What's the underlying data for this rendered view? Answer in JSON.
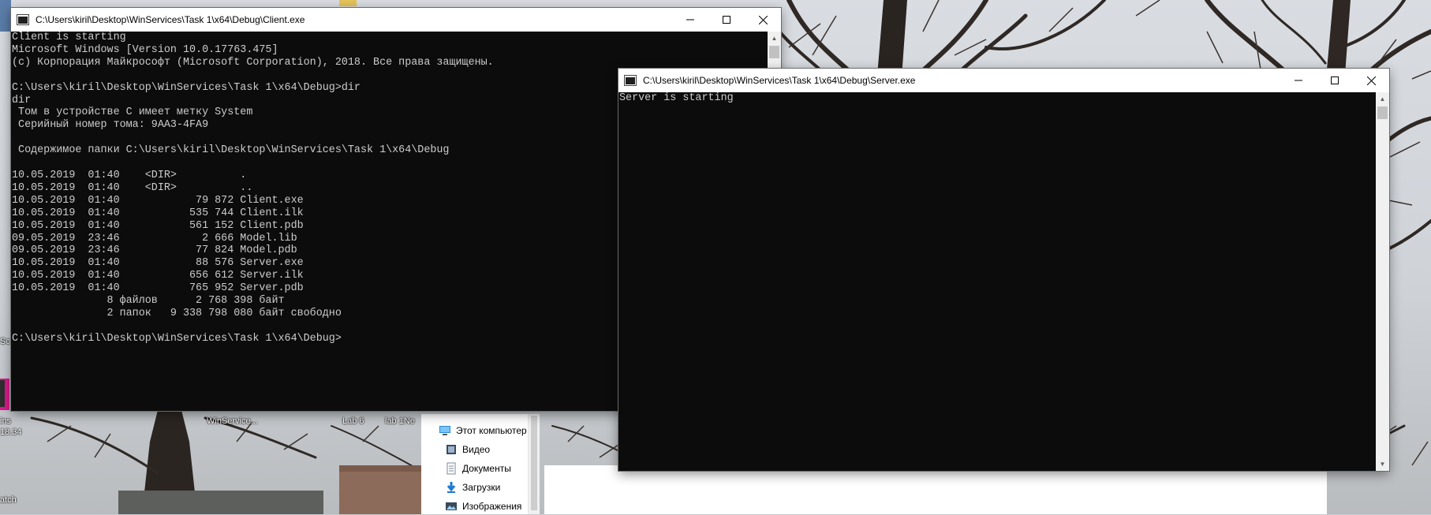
{
  "client_window": {
    "title": "C:\\Users\\kiril\\Desktop\\WinServices\\Task 1\\x64\\Debug\\Client.exe",
    "lines": [
      "Client is starting",
      "Microsoft Windows [Version 10.0.17763.475]",
      "(c) Корпорация Майкрософт (Microsoft Corporation), 2018. Все права защищены.",
      "",
      "C:\\Users\\kiril\\Desktop\\WinServices\\Task 1\\x64\\Debug>dir",
      "dir",
      " Том в устройстве C имеет метку System",
      " Серийный номер тома: 9AA3-4FA9",
      "",
      " Содержимое папки C:\\Users\\kiril\\Desktop\\WinServices\\Task 1\\x64\\Debug",
      "",
      "10.05.2019  01:40    <DIR>          .",
      "10.05.2019  01:40    <DIR>          ..",
      "10.05.2019  01:40            79 872 Client.exe",
      "10.05.2019  01:40           535 744 Client.ilk",
      "10.05.2019  01:40           561 152 Client.pdb",
      "09.05.2019  23:46             2 666 Model.lib",
      "09.05.2019  23:46            77 824 Model.pdb",
      "10.05.2019  01:40            88 576 Server.exe",
      "10.05.2019  01:40           656 612 Server.ilk",
      "10.05.2019  01:40           765 952 Server.pdb",
      "               8 файлов      2 768 398 байт",
      "               2 папок   9 338 798 080 байт свободно",
      "",
      "C:\\Users\\kiril\\Desktop\\WinServices\\Task 1\\x64\\Debug>"
    ]
  },
  "server_window": {
    "title": "C:\\Users\\kiril\\Desktop\\WinServices\\Task 1\\x64\\Debug\\Server.exe",
    "lines": [
      "Server is starting"
    ]
  },
  "window_controls": {
    "minimize": "—",
    "maximize": "☐",
    "close": "✕"
  },
  "desktop": {
    "labels": [
      "WinService...",
      "Lab 6",
      "lab 1Ne",
      "ins",
      "18.34",
      "Sc",
      "atch"
    ]
  },
  "explorer_nav": [
    {
      "label": "Этот компьютер",
      "icon": "computer-icon"
    },
    {
      "label": "Видео",
      "icon": "video-folder-icon"
    },
    {
      "label": "Документы",
      "icon": "documents-folder-icon"
    },
    {
      "label": "Загрузки",
      "icon": "downloads-folder-icon"
    },
    {
      "label": "Изображения",
      "icon": "pictures-folder-icon"
    }
  ],
  "colors": {
    "console_background": "#0c0c0c",
    "console_text": "#cccccc",
    "titlebar": "#ffffff"
  }
}
